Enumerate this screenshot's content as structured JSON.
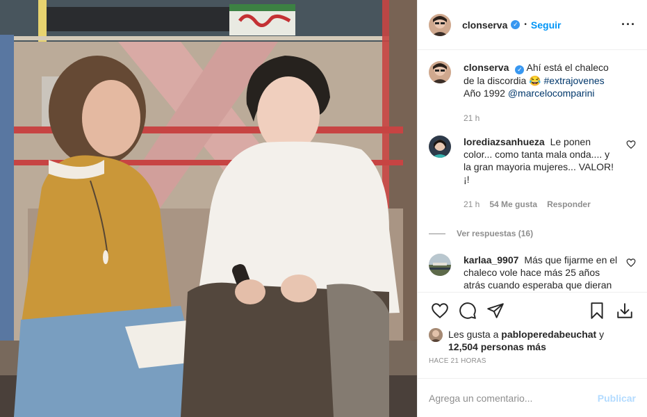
{
  "post": {
    "author": "clonserva",
    "follow_label": "Seguir",
    "more_icon": "more-horizontal-icon",
    "separator": "•"
  },
  "caption": {
    "user": "clonserva",
    "text": "Ahí está el chaleco de la discordia 😂",
    "hashtag": "#extrajovenes",
    "line2": "Año 1992",
    "mention": "@marcelocomparini",
    "time": "21 h"
  },
  "comments": [
    {
      "user": "lorediazsanhueza",
      "text": "Le ponen color... como tanta mala onda.... y la gran mayoria mujeres... VALOR!¡!",
      "time": "21 h",
      "likes": "54 Me gusta",
      "reply_label": "Responder",
      "view_replies": "Ver respuestas (16)"
    },
    {
      "user": "karlaa_9907",
      "text": "Más que fijarme en el chaleco vole hace más 25 años atrás cuando esperaba que dieran el extra jóvenes.. que bellos"
    }
  ],
  "likes": {
    "prefix": "Les gusta a",
    "user": "pabloperedabeuchat",
    "conj": "y",
    "others": "12,504 personas más"
  },
  "timestamp": "HACE 21 HORAS",
  "add_comment": {
    "placeholder": "Agrega un comentario...",
    "publish_label": "Publicar"
  },
  "colors": {
    "accent": "#0095f6",
    "verified": "#3897f0",
    "muted": "#8e8e8e",
    "publish_disabled": "#b3dbff"
  }
}
